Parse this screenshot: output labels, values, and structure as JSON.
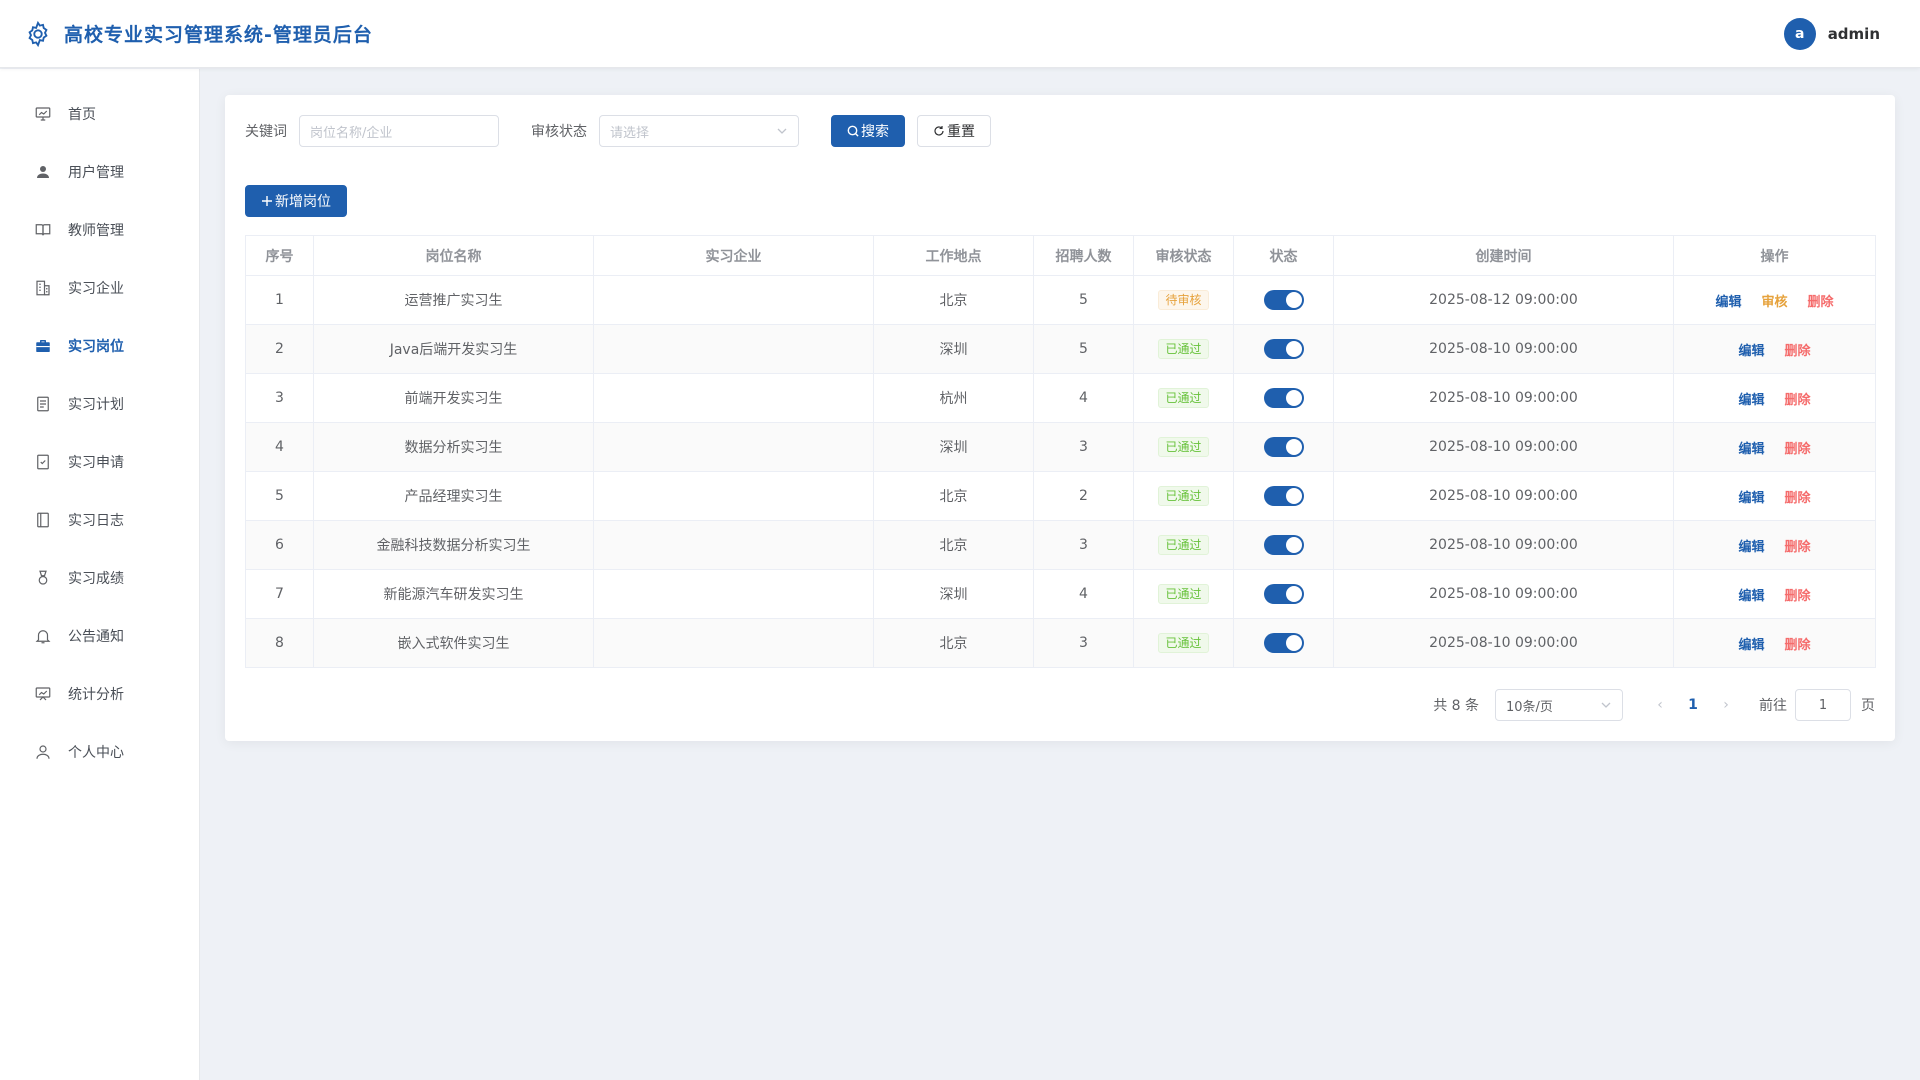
{
  "header": {
    "title": "高校专业实习管理系统-管理员后台",
    "avatar_letter": "a",
    "username": "admin"
  },
  "colors": {
    "primary": "#1f5fae",
    "warning": "#e6a23c",
    "success": "#67c23a",
    "danger": "#f56c6c"
  },
  "sidebar": {
    "items": [
      {
        "label": "首页",
        "icon": "dashboard-icon"
      },
      {
        "label": "用户管理",
        "icon": "user-icon"
      },
      {
        "label": "教师管理",
        "icon": "book-icon"
      },
      {
        "label": "实习企业",
        "icon": "building-icon"
      },
      {
        "label": "实习岗位",
        "icon": "briefcase-icon",
        "active": true
      },
      {
        "label": "实习计划",
        "icon": "document-icon"
      },
      {
        "label": "实习申请",
        "icon": "checklist-icon"
      },
      {
        "label": "实习日志",
        "icon": "notebook-icon"
      },
      {
        "label": "实习成绩",
        "icon": "medal-icon"
      },
      {
        "label": "公告通知",
        "icon": "bell-icon"
      },
      {
        "label": "统计分析",
        "icon": "chart-icon"
      },
      {
        "label": "个人中心",
        "icon": "person-icon"
      }
    ]
  },
  "filters": {
    "keyword_label": "关键词",
    "keyword_placeholder": "岗位名称/企业",
    "status_label": "审核状态",
    "status_placeholder": "请选择",
    "search_button": "搜索",
    "reset_button": "重置"
  },
  "add_button": "新增岗位",
  "table": {
    "columns": [
      "序号",
      "岗位名称",
      "实习企业",
      "工作地点",
      "招聘人数",
      "审核状态",
      "状态",
      "创建时间",
      "操作"
    ],
    "rows": [
      {
        "no": "1",
        "name": "运营推广实习生",
        "company": "",
        "location": "北京",
        "count": "5",
        "audit": "待审核",
        "audit_type": "warn",
        "enabled": true,
        "created": "2025-08-12 09:00:00",
        "actions": [
          "编辑",
          "审核",
          "删除"
        ]
      },
      {
        "no": "2",
        "name": "Java后端开发实习生",
        "company": "",
        "location": "深圳",
        "count": "5",
        "audit": "已通过",
        "audit_type": "ok",
        "enabled": true,
        "created": "2025-08-10 09:00:00",
        "actions": [
          "编辑",
          "删除"
        ]
      },
      {
        "no": "3",
        "name": "前端开发实习生",
        "company": "",
        "location": "杭州",
        "count": "4",
        "audit": "已通过",
        "audit_type": "ok",
        "enabled": true,
        "created": "2025-08-10 09:00:00",
        "actions": [
          "编辑",
          "删除"
        ]
      },
      {
        "no": "4",
        "name": "数据分析实习生",
        "company": "",
        "location": "深圳",
        "count": "3",
        "audit": "已通过",
        "audit_type": "ok",
        "enabled": true,
        "created": "2025-08-10 09:00:00",
        "actions": [
          "编辑",
          "删除"
        ]
      },
      {
        "no": "5",
        "name": "产品经理实习生",
        "company": "",
        "location": "北京",
        "count": "2",
        "audit": "已通过",
        "audit_type": "ok",
        "enabled": true,
        "created": "2025-08-10 09:00:00",
        "actions": [
          "编辑",
          "删除"
        ]
      },
      {
        "no": "6",
        "name": "金融科技数据分析实习生",
        "company": "",
        "location": "北京",
        "count": "3",
        "audit": "已通过",
        "audit_type": "ok",
        "enabled": true,
        "created": "2025-08-10 09:00:00",
        "actions": [
          "编辑",
          "删除"
        ]
      },
      {
        "no": "7",
        "name": "新能源汽车研发实习生",
        "company": "",
        "location": "深圳",
        "count": "4",
        "audit": "已通过",
        "audit_type": "ok",
        "enabled": true,
        "created": "2025-08-10 09:00:00",
        "actions": [
          "编辑",
          "删除"
        ]
      },
      {
        "no": "8",
        "name": "嵌入式软件实习生",
        "company": "",
        "location": "北京",
        "count": "3",
        "audit": "已通过",
        "audit_type": "ok",
        "enabled": true,
        "created": "2025-08-10 09:00:00",
        "actions": [
          "编辑",
          "删除"
        ]
      }
    ]
  },
  "pagination": {
    "total_text": "共 8 条",
    "page_size": "10条/页",
    "current_page": "1",
    "goto_label": "前往",
    "goto_value": "1",
    "goto_suffix": "页"
  }
}
